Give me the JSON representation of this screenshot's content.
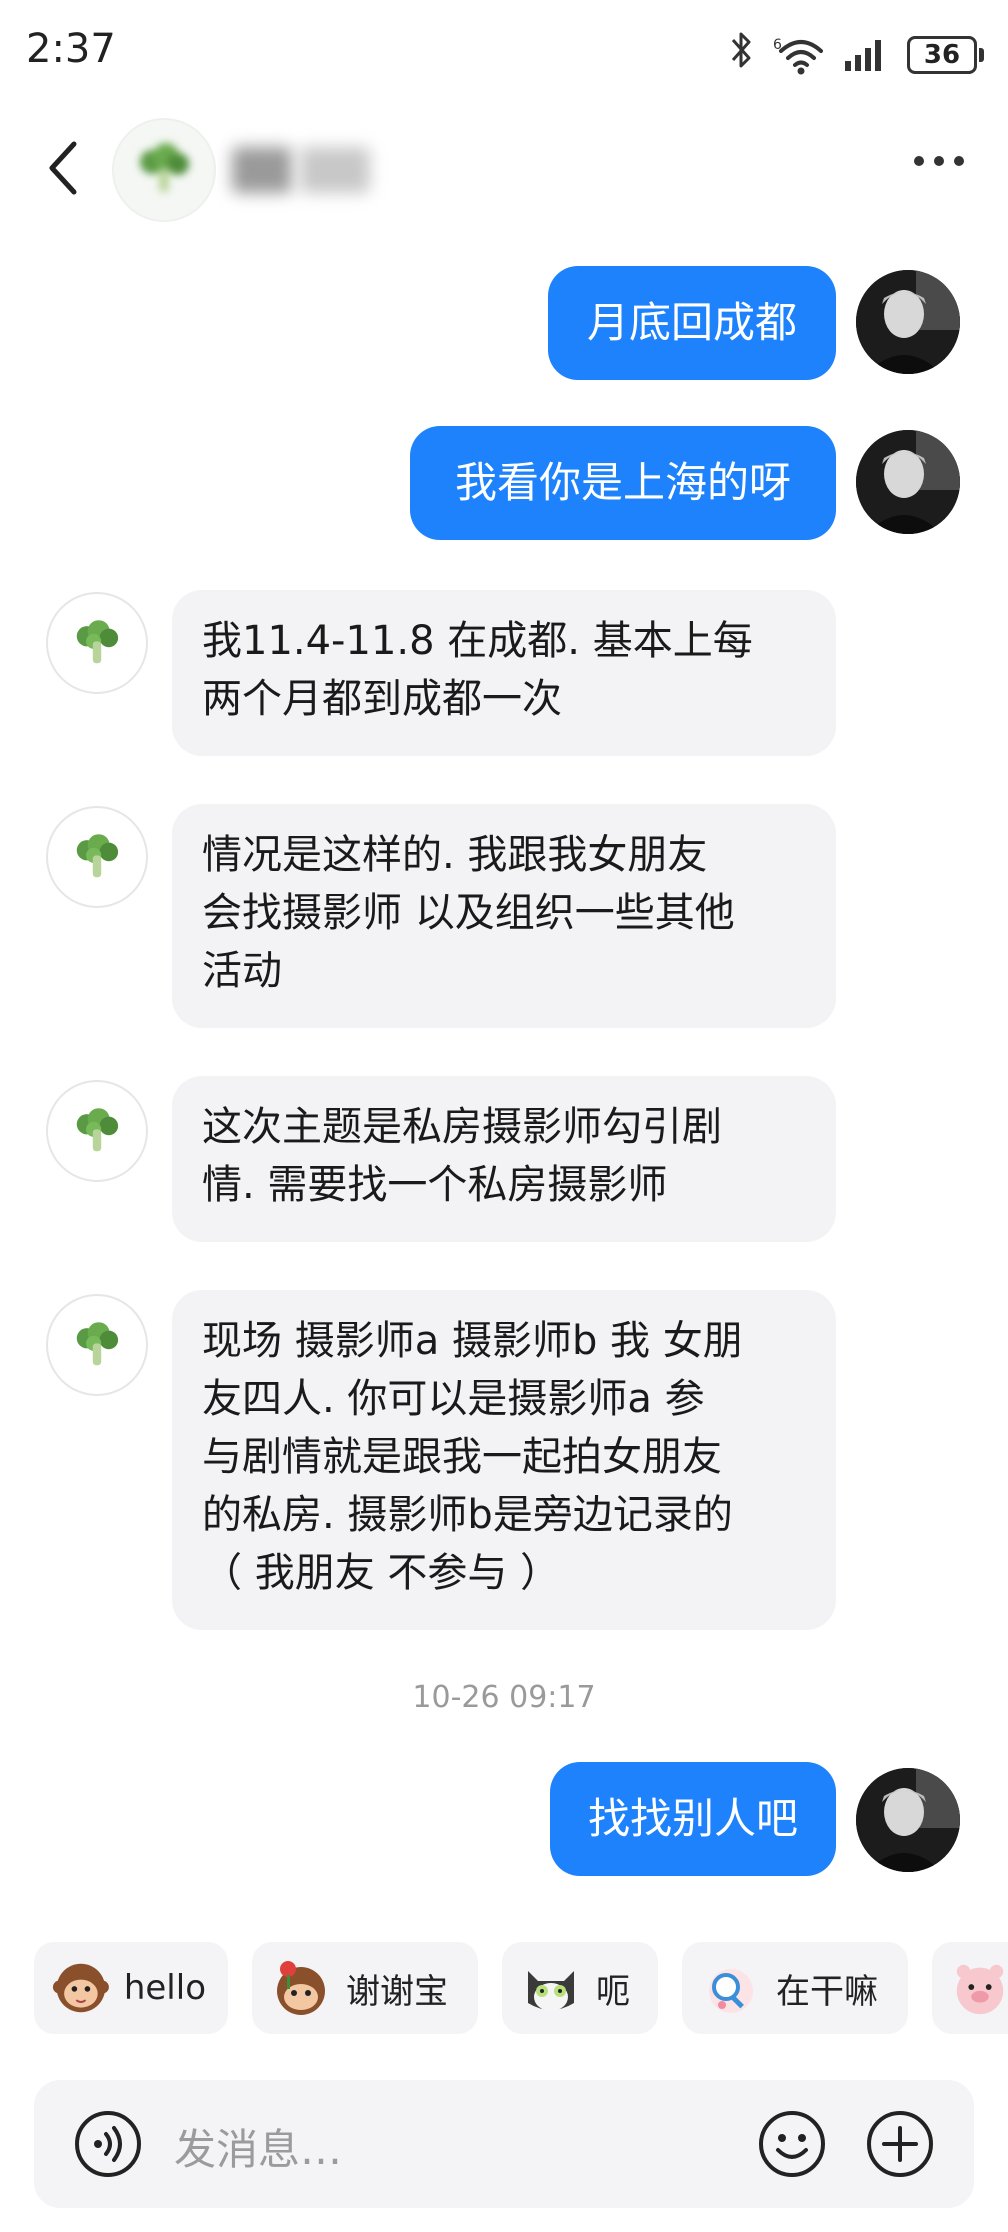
{
  "status_bar": {
    "time": "2:37",
    "battery": "36",
    "icons": [
      "bluetooth-icon",
      "wifi-icon",
      "signal-icon",
      "battery-icon"
    ]
  },
  "header": {
    "icons": [
      "back-arrow-icon",
      "broccoli-avatar-icon",
      "more-dots-icon"
    ]
  },
  "messages": [
    {
      "from": "me",
      "text": "月底回成都"
    },
    {
      "from": "me",
      "text": "我看你是上海的呀"
    },
    {
      "from": "them",
      "lines": [
        "我11.4-11.8 在成都. 基本上每",
        "两个月都到成都一次"
      ]
    },
    {
      "from": "them",
      "lines": [
        "情况是这样的. 我跟我女朋友",
        "会找摄影师 以及组织一些其他",
        "活动"
      ]
    },
    {
      "from": "them",
      "lines": [
        "这次主题是私房摄影师勾引剧",
        "情. 需要找一个私房摄影师"
      ]
    },
    {
      "from": "them",
      "lines": [
        "现场 摄影师a 摄影师b 我 女朋",
        "友四人.  你可以是摄影师a 参",
        "与剧情就是跟我一起拍女朋友",
        "的私房. 摄影师b是旁边记录的",
        "（ 我朋友 不参与 ）"
      ]
    },
    {
      "from": "me",
      "text": "找找别人吧"
    }
  ],
  "timestamp": "10-26 09:17",
  "stickers": [
    {
      "label": "hello",
      "icon": "monkey-sticker-icon"
    },
    {
      "label": "谢谢宝",
      "icon": "flower-monkey-sticker-icon"
    },
    {
      "label": "呃",
      "icon": "cat-sticker-icon"
    },
    {
      "label": "在干嘛",
      "icon": "magnifier-sticker-icon"
    },
    {
      "label": "",
      "icon": "pig-sticker-icon"
    }
  ],
  "input": {
    "placeholder": "发消息…",
    "icons": [
      "voice-icon",
      "emoji-icon",
      "plus-icon"
    ]
  },
  "colors": {
    "my_bubble": "#1d82fb",
    "their_bubble": "#f3f3f5",
    "timestamp": "#9a9a9a"
  }
}
